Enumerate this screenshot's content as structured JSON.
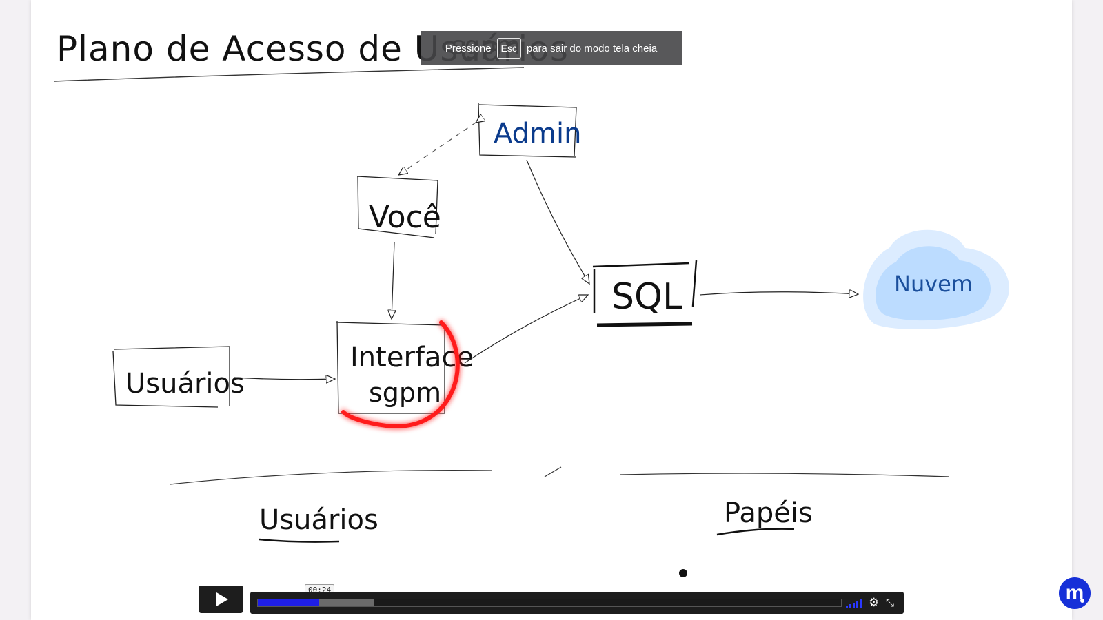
{
  "whiteboard": {
    "title": "Plano de Acesso de Usuários",
    "title_partial": "sgpm",
    "nodes": {
      "admin": "Admin",
      "voce": "Você",
      "interface_line1": "Interface",
      "interface_line2": "sgpm",
      "usuarios": "Usuários",
      "sql": "SQL",
      "nuvem": "Nuvem"
    },
    "bottom": {
      "left": "Usuários",
      "right": "Papéis"
    },
    "colors": {
      "admin_text": "#0b3b8c",
      "cloud_fill": "#bcdcff",
      "cloud_glow": "#dcecff",
      "highlight": "#e00000"
    }
  },
  "fullscreen_banner": {
    "prefix": "Pressione",
    "key": "Esc",
    "suffix": "para sair do modo tela cheia"
  },
  "player": {
    "time_tooltip": "00:24",
    "progress_played": 0.105,
    "progress_buffered": 0.2,
    "play_icon": "play-icon",
    "settings_icon": "gear-icon",
    "fullscreen_icon": "exit-fullscreen-icon"
  },
  "logo": {
    "letter": "m"
  }
}
